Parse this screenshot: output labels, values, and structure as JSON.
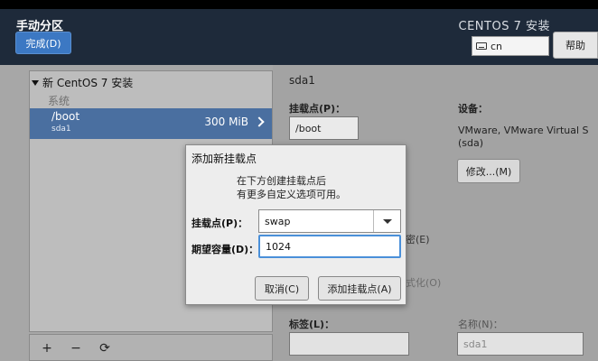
{
  "header": {
    "title": "手动分区",
    "done_label": "完成(D)",
    "product": "CENTOS 7 安装",
    "keyboard": {
      "icon": "keyboard-icon",
      "layout": "cn"
    },
    "help_label": "帮助"
  },
  "left_panel": {
    "group_title": "新 CentOS 7 安装",
    "system_label": "系统",
    "selected": {
      "mount": "/boot",
      "device": "sda1",
      "size": "300 MiB"
    },
    "toolbar": {
      "add": "+",
      "remove": "−",
      "refresh": "⟳"
    }
  },
  "detail": {
    "device_title": "sda1",
    "mount_label": "挂载点(P)：",
    "mount_value": "/boot",
    "device_label": "设备：",
    "device_value": "VMware, VMware Virtual S",
    "device_id": "(sda)",
    "modify_label": "修改...(M)",
    "fragment_encrypt": "密(E)",
    "fragment_format": "式化(O)",
    "tag_label": "标签(L)：",
    "tag_value": "",
    "name_label": "名称(N)：",
    "name_value": "sda1"
  },
  "dialog": {
    "title": "添加新挂载点",
    "desc_line1": "在下方创建挂载点后",
    "desc_line2": "有更多自定义选项可用。",
    "mount_label": "挂载点(P)：",
    "mount_value": "swap",
    "capacity_label": "期望容量(D)：",
    "capacity_value": "1024",
    "cancel_label": "取消(C)",
    "add_label": "添加挂载点(A)"
  }
}
